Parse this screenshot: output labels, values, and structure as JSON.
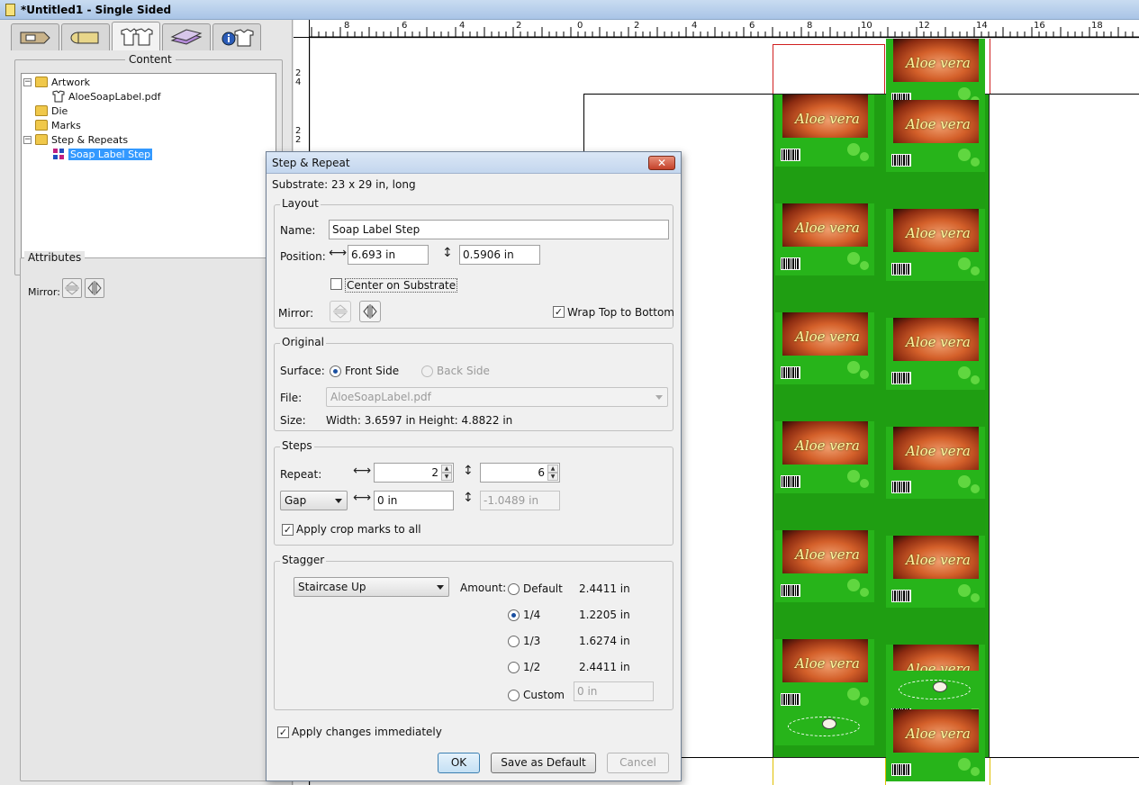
{
  "window": {
    "title": "*Untitled1 - Single Sided"
  },
  "left_panel": {
    "tabs": [
      {
        "icon": "price-tag-icon"
      },
      {
        "icon": "rolls-icon"
      },
      {
        "icon": "shirts-icon"
      },
      {
        "icon": "stack-sheets-icon"
      },
      {
        "icon": "info-shirt-icon"
      }
    ],
    "content_label": "Content",
    "tree": {
      "artwork": "Artwork",
      "artwork_file": "AloeSoapLabel.pdf",
      "die": "Die",
      "marks": "Marks",
      "step_repeats": "Step & Repeats",
      "step_item": "Soap Label Step"
    },
    "attributes_label": "Attributes",
    "mirror_label": "Mirror:"
  },
  "rulers": {
    "top_ticks": [
      "8",
      "6",
      "4",
      "2",
      "0",
      "2",
      "4",
      "6",
      "8",
      "10",
      "12",
      "14",
      "16",
      "18"
    ],
    "left_ticks": [
      "2",
      "4",
      "2",
      "2"
    ]
  },
  "artwork": {
    "brand": "Aloe vera"
  },
  "dialog": {
    "title": "Step & Repeat",
    "close_glyph": "✕",
    "substrate": "Substrate:  23 x 29 in, long",
    "layout": {
      "legend": "Layout",
      "name_label": "Name:",
      "name_value": "Soap Label Step",
      "position_label": "Position:",
      "position_x": "6.693 in",
      "position_y": "0.5906 in",
      "center_on_substrate": "Center on Substrate",
      "mirror_label": "Mirror:",
      "wrap_top_to_bottom": "Wrap Top to Bottom"
    },
    "original": {
      "legend": "Original",
      "surface_label": "Surface:",
      "front_side": "Front Side",
      "back_side": "Back Side",
      "file_label": "File:",
      "file_value": "AloeSoapLabel.pdf",
      "size_label": "Size:",
      "width": "Width:  3.6597 in",
      "height": "Height:  4.8822 in"
    },
    "steps": {
      "legend": "Steps",
      "repeat_label": "Repeat:",
      "repeat_x": "2",
      "repeat_y": "6",
      "gap_option": "Gap",
      "gap_x": "0 in",
      "gap_y": "-1.0489 in",
      "apply_crop_marks": "Apply crop marks to all"
    },
    "stagger": {
      "legend": "Stagger",
      "mode": "Staircase Up",
      "amount_label": "Amount:",
      "options": [
        {
          "label": "Default",
          "value": "2.4411 in"
        },
        {
          "label": "1/4",
          "value": "1.2205 in"
        },
        {
          "label": "1/3",
          "value": "1.6274 in"
        },
        {
          "label": "1/2",
          "value": "2.4411 in"
        },
        {
          "label": "Custom",
          "value": "0 in"
        }
      ]
    },
    "apply_changes": "Apply changes immediately",
    "buttons": {
      "ok": "OK",
      "save_default": "Save as Default",
      "cancel": "Cancel"
    }
  }
}
